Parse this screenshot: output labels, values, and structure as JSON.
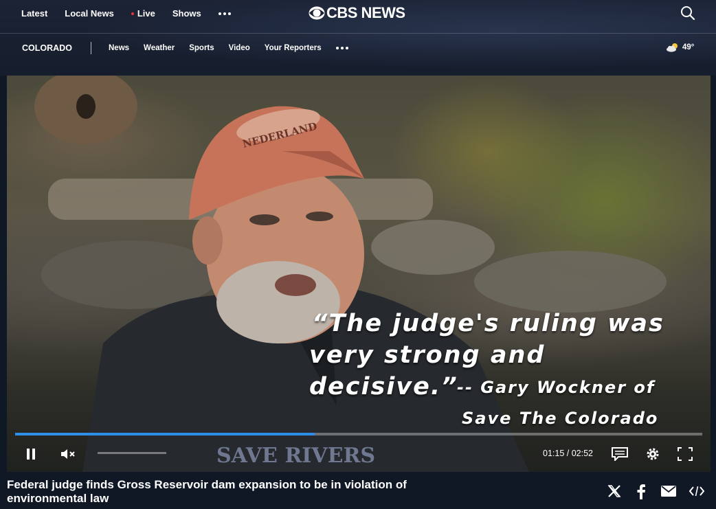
{
  "header": {
    "top_nav": [
      {
        "label": "Latest"
      },
      {
        "label": "Local News"
      },
      {
        "label": "Live"
      },
      {
        "label": "Shows"
      }
    ],
    "logo_text": "CBS NEWS",
    "region": "COLORADO",
    "section_nav": [
      {
        "label": "News"
      },
      {
        "label": "Weather"
      },
      {
        "label": "Sports"
      },
      {
        "label": "Video"
      },
      {
        "label": "Your Reporters"
      }
    ],
    "weather": {
      "temp": "49°",
      "icon": "partly-cloudy-icon"
    }
  },
  "video": {
    "quote_line1": "“The judge's ruling was",
    "quote_line2": "very strong and decisive.”",
    "attribution_line1": "-- Gary Wockner of",
    "attribution_line2": "Save The Colorado",
    "cap_text": "NEDERLAND",
    "shirt_text": "SAVE RIVERS",
    "time_display": "01:15 / 02:52",
    "progress_fraction": 0.436,
    "state": "playing",
    "muted": true
  },
  "caption": {
    "headline": "Federal judge finds Gross Reservoir dam expansion to be in violation of environmental law"
  },
  "share_icons": [
    "x-icon",
    "facebook-icon",
    "email-icon",
    "embed-icon"
  ],
  "colors": {
    "background": "#101826",
    "progress": "#2f8ee8",
    "live_dot": "#e8343c"
  }
}
